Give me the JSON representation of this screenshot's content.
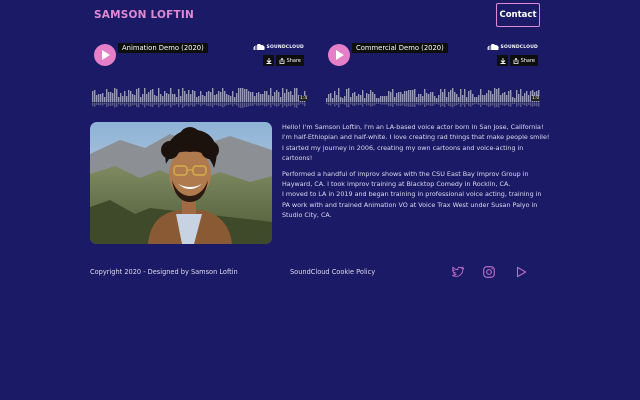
{
  "header": {
    "brand": "SAMSON LOFTIN",
    "contact_label": "Contact"
  },
  "players": [
    {
      "title": "Animation Demo (2020)",
      "sc_label": "SOUNDCLOUD",
      "share_label": "Share",
      "duration": "1:4"
    },
    {
      "title": "Commercial Demo (2020)",
      "sc_label": "SOUNDCLOUD",
      "share_label": "Share",
      "duration": "1:0"
    }
  ],
  "about": {
    "paragraphs": [
      "Hello! I'm Samson Loftin, I'm an LA-based voice actor born in San Jose, California! I'm half-Ethiopian and half-white. I love creating rad things that make people smile! I started my journey in 2006, creating my own cartoons and voice-acting in cartoons!",
      "Performed a handful of improv shows with the CSU East Bay Improv Group in Hayward, CA. I took improv training at Blacktop Comedy in Rocklin, CA.",
      "I moved to LA in 2019 and began training in professional voice acting, training in PA work with and trained Animation VO at Voice Trax West under Susan Palyo in Studio City, CA."
    ]
  },
  "footer": {
    "copyright": "Copyright 2020 - Designed by Samson Loftin",
    "cookie_link": "SoundCloud Cookie Policy",
    "social_icons": [
      "twitter-icon",
      "instagram-icon",
      "play-icon"
    ]
  },
  "colors": {
    "background": "#1a1a66",
    "accent": "#e08ad4",
    "play_button": "#e47fc8"
  }
}
